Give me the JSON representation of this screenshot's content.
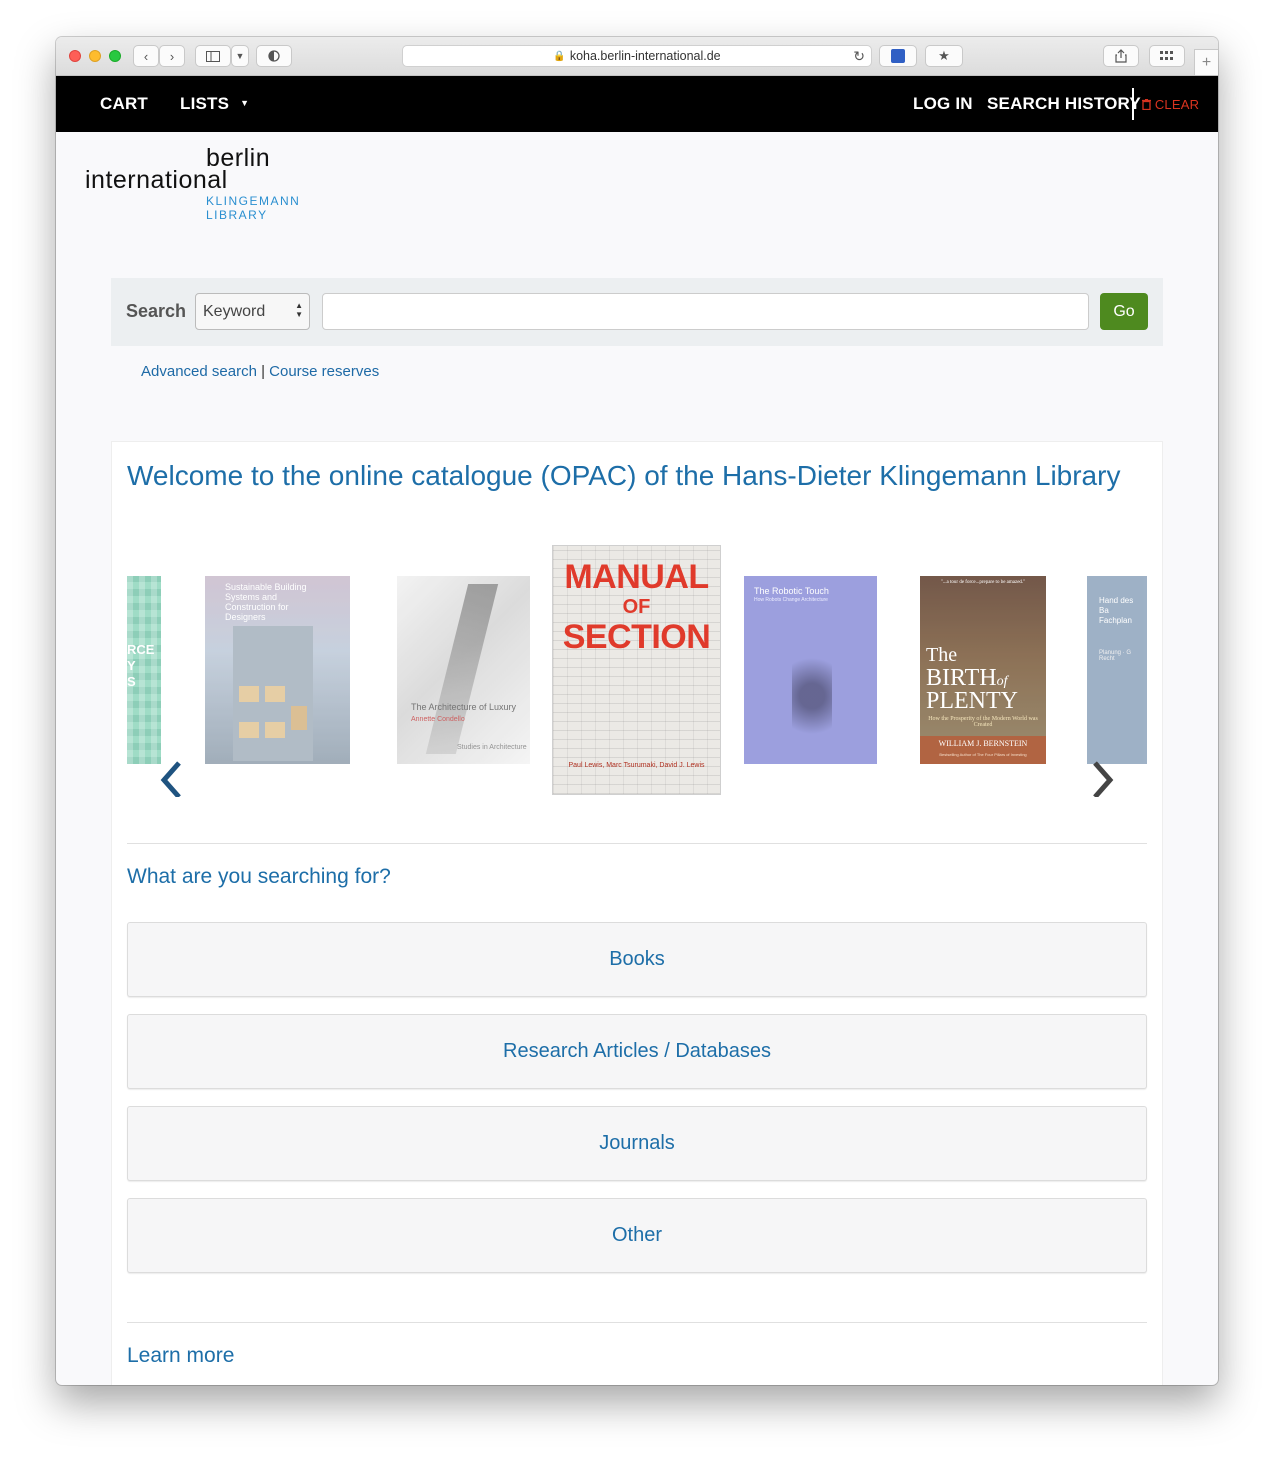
{
  "browser": {
    "url": "koha.berlin-international.de"
  },
  "nav": {
    "cart": "CART",
    "lists": "LISTS",
    "login": "LOG IN",
    "search_history": "SEARCH HISTORY",
    "clear": "CLEAR"
  },
  "logo": {
    "line1": "berlin",
    "line2": "international",
    "line3": "KLINGEMANN",
    "line4": "LIBRARY"
  },
  "search": {
    "label": "Search",
    "select_value": "Keyword",
    "input_value": "",
    "go_label": "Go"
  },
  "links": {
    "advanced": "Advanced search",
    "separator": "|",
    "course_reserves": "Course reserves"
  },
  "main": {
    "welcome": "Welcome to the online catalogue (OPAC) of the Hans-Dieter Klingemann Library",
    "carousel": {
      "books": [
        {
          "title_fragment": "RCE\nY\nS",
          "color": "#8fd6bd"
        },
        {
          "title_fragment": "Sustainable Building Systems and Construction for Designers",
          "color": "#b9c6d6"
        },
        {
          "title_fragment": "The Architecture of Luxury",
          "author": "Annette Condello",
          "series": "Studies in Architecture",
          "color": "#e4e4e4"
        },
        {
          "title_l1": "MANUAL",
          "title_l2": "OF",
          "title_l3": "SECTION",
          "authors": "Paul Lewis, Marc Tsurumaki, David J. Lewis",
          "color": "#ebe9e5"
        },
        {
          "title_fragment": "The Robotic Touch",
          "subtitle": "How Robots Change Architecture",
          "color": "#8b8fd9"
        },
        {
          "quote": "\"...a tour de force...prepare to be amazed.\"",
          "title_l1": "The",
          "title_l2": "BIRTH",
          "title_of": "of",
          "title_l3": "PLENTY",
          "subtitle": "How the Prosperity of the Modern World was Created",
          "author": "WILLIAM J. BERNSTEIN",
          "tagline": "Bestselling Author of The Four Pillars of Investing",
          "color": "#7a5a3a"
        },
        {
          "title_fragment": "Hand des Ba Fachplan",
          "extra": "Planung · G Recht",
          "color": "#8ea4bd"
        }
      ]
    },
    "question": "What are you searching for?",
    "categories": [
      "Books",
      "Research Articles / Databases",
      "Journals",
      "Other"
    ],
    "learn_more": "Learn more"
  },
  "colors": {
    "nav_bg": "#000000",
    "accent_link": "#1d6ea8",
    "go_button": "#4e8a1f",
    "clear": "#d9331f",
    "logo_blue": "#2a8fd0"
  }
}
